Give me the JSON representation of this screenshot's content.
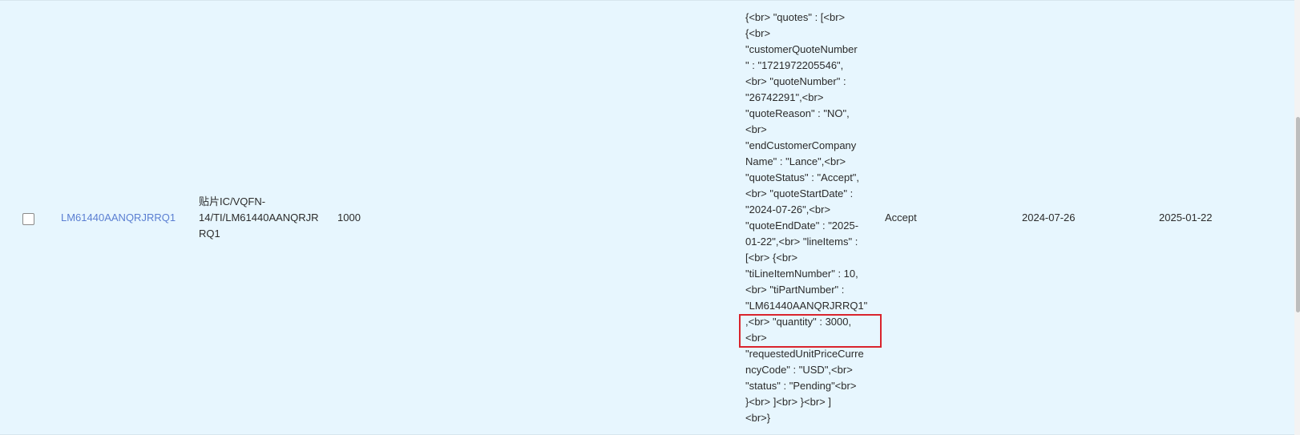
{
  "row": {
    "part_number": "LM61440AANQRJRRQ1",
    "description_lines": [
      "贴片IC/VQFN-",
      "14/TI/LM61440AANQRJR",
      "RQ1"
    ],
    "quantity": "1000",
    "response_json_lines": [
      "{<br> \"quotes\" : [<br>",
      "{<br>",
      "\"customerQuoteNumber",
      "\" : \"1721972205546\",",
      "<br> \"quoteNumber\" :",
      "\"26742291\",<br>",
      "\"quoteReason\" : \"NO\",",
      "<br>",
      "\"endCustomerCompany",
      "Name\" : \"Lance\",<br>",
      "\"quoteStatus\" : \"Accept\",",
      "<br> \"quoteStartDate\" :",
      "\"2024-07-26\",<br>",
      "\"quoteEndDate\" : \"2025-",
      "01-22\",<br> \"lineItems\" :",
      "[<br> {<br>",
      "\"tiLineItemNumber\" : 10,",
      "<br> \"tiPartNumber\" :",
      "\"LM61440AANQRJRRQ1\"",
      ",<br> \"quantity\" : 3000,",
      "<br>",
      "\"requestedUnitPriceCurre",
      "ncyCode\" : \"USD\",<br>",
      "\"status\" : \"Pending\"<br>",
      "}<br> ]<br> }<br> ]",
      "<br>}"
    ],
    "quote_status": "Accept",
    "start_date": "2024-07-26",
    "end_date": "2025-01-22"
  },
  "colors": {
    "row_background": "#e7f6fe",
    "link": "#5b7fd2",
    "highlight_border": "#d9242d"
  }
}
